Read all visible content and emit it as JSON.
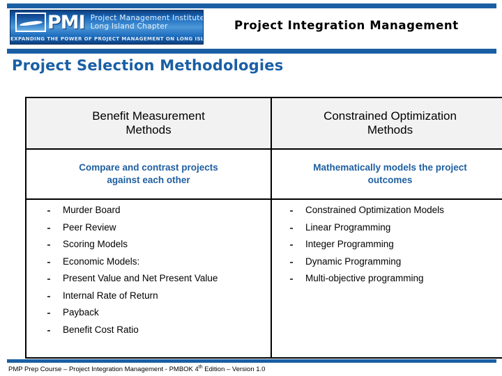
{
  "brand": {
    "logo_pmi_text": "PMI",
    "logo_line1": "Project Management Institute",
    "logo_line2": "Long Island Chapter",
    "logo_tagline": "EXPANDING THE POWER OF PROJECT MANAGEMENT ON LONG ISLAND"
  },
  "header": {
    "slide_title": "Project Integration Management"
  },
  "section": {
    "heading": "Project Selection Methodologies"
  },
  "table": {
    "headers": [
      "Benefit Measurement Methods",
      "Constrained Optimization Methods"
    ],
    "headers_lines": [
      [
        "Benefit Measurement",
        "Methods"
      ],
      [
        "Constrained Optimization",
        "Methods"
      ]
    ],
    "subheads_lines": [
      [
        "Compare and contrast projects",
        "against each other"
      ],
      [
        "Mathematically models the project",
        "outcomes"
      ]
    ],
    "subheads": [
      "Compare and contrast projects against each other",
      "Mathematically models the project outcomes"
    ],
    "left_items": [
      "Murder Board",
      "Peer Review",
      "Scoring Models",
      "Economic Models:",
      "Present Value and Net Present Value",
      "Internal Rate of Return",
      "Payback",
      "Benefit Cost Ratio"
    ],
    "right_items": [
      "Constrained Optimization Models",
      "Linear Programming",
      "Integer Programming",
      "Dynamic Programming",
      "Multi-objective programming"
    ]
  },
  "footer": {
    "text_before": "PMP Prep Course – Project Integration Management - PMBOK 4",
    "text_sup": "th",
    "text_after": " Edition – Version 1.0"
  },
  "colors": {
    "brand_blue": "#1A5FA4",
    "subhead_blue": "#1F5FA0",
    "header_cell_bg": "#F2F2F2",
    "border": "#000000"
  }
}
